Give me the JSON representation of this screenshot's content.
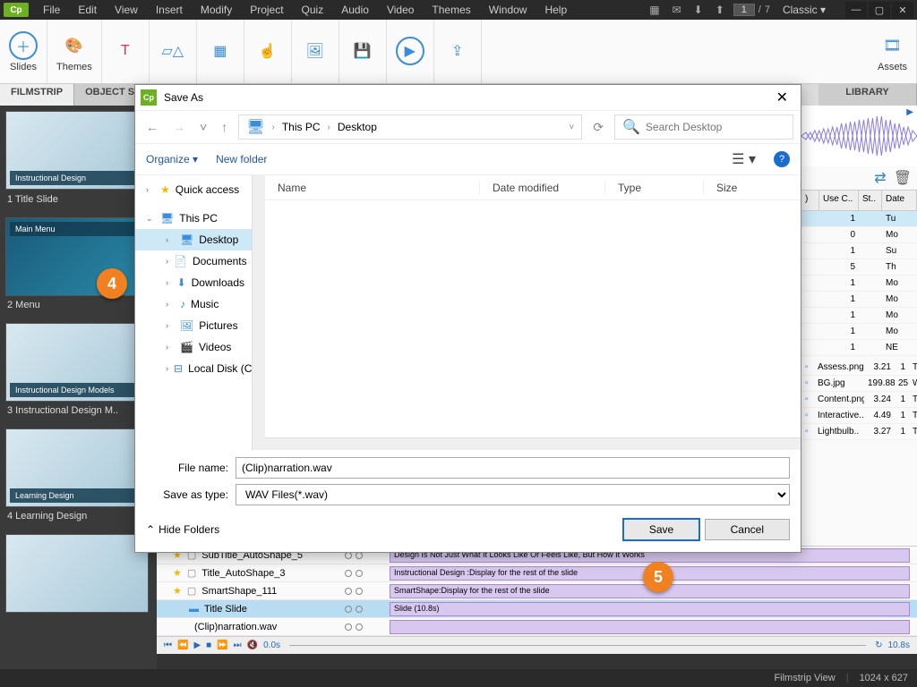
{
  "menu": [
    "File",
    "Edit",
    "View",
    "Insert",
    "Modify",
    "Project",
    "Quiz",
    "Audio",
    "Video",
    "Themes",
    "Window",
    "Help"
  ],
  "page": {
    "current": "1",
    "total": "7"
  },
  "workspace": "Classic",
  "ribbon": {
    "slides": "Slides",
    "themes": "Themes",
    "assets": "Assets"
  },
  "panel_tabs": {
    "filmstrip": "FILMSTRIP",
    "objstate": "OBJECT STA",
    "library": "LIBRARY"
  },
  "slides": [
    {
      "label": "1 Title Slide",
      "title": "Instructional Design"
    },
    {
      "label": "2 Menu",
      "title": "Main Menu"
    },
    {
      "label": "3 Instructional Design M..",
      "title": "Instructional Design Models"
    },
    {
      "label": "4 Learning Design",
      "title": "Learning Design"
    }
  ],
  "callouts": {
    "four": "4",
    "five": "5"
  },
  "dialog": {
    "title": "Save As",
    "crumb1": "This PC",
    "crumb2": "Desktop",
    "search_placeholder": "Search Desktop",
    "organize": "Organize",
    "newfolder": "New folder",
    "tree": {
      "quick": "Quick access",
      "thispc": "This PC",
      "desktop": "Desktop",
      "documents": "Documents",
      "downloads": "Downloads",
      "music": "Music",
      "pictures": "Pictures",
      "videos": "Videos",
      "local": "Local Disk (C:)"
    },
    "cols": {
      "name": "Name",
      "date": "Date modified",
      "type": "Type",
      "size": "Size"
    },
    "filename_label": "File name:",
    "filename": "(Clip)narration.wav",
    "type_label": "Save as type:",
    "type": "WAV Files(*.wav)",
    "hide": "Hide Folders",
    "save": "Save",
    "cancel": "Cancel"
  },
  "library_cols": {
    "usec": "Use C..",
    "st": "St..",
    "date": "Date"
  },
  "library_rows": [
    {
      "use": "1",
      "st": "",
      "d": "Tu"
    },
    {
      "use": "0",
      "st": "",
      "d": "Mo"
    },
    {
      "use": "1",
      "st": "",
      "d": "Su"
    },
    {
      "use": "5",
      "st": "",
      "d": "Th"
    },
    {
      "use": "1",
      "st": "",
      "d": "Mo"
    },
    {
      "use": "1",
      "st": "",
      "d": "Mo"
    },
    {
      "use": "1",
      "st": "",
      "d": "Mo"
    },
    {
      "use": "1",
      "st": "",
      "d": "Mo"
    },
    {
      "use": "1",
      "st": "",
      "d": "NE"
    }
  ],
  "library_files": [
    {
      "name": "Assess.png",
      "size": "3.21",
      "use": "1",
      "d": "Tu"
    },
    {
      "name": "BG.jpg",
      "size": "199.88",
      "use": "25",
      "d": "We"
    },
    {
      "name": "Content.png",
      "size": "3.24",
      "use": "1",
      "d": "Tu"
    },
    {
      "name": "Interactive..",
      "size": "4.49",
      "use": "1",
      "d": "Tu"
    },
    {
      "name": "Lightbulb..",
      "size": "3.27",
      "use": "1",
      "d": "Tu"
    }
  ],
  "timeline": {
    "rows": [
      {
        "name": "SubTitle_AutoShape_5",
        "clip": "Design Is Not Just What It Looks Like Or Feels Like, But How It Works"
      },
      {
        "name": "Title_AutoShape_3",
        "clip": "Instructional Design :Display for the rest of the slide"
      },
      {
        "name": "SmartShape_111",
        "clip": "SmartShape:Display for the rest of the slide"
      },
      {
        "name": "Title Slide",
        "clip": "Slide (10.8s)"
      },
      {
        "name": "(Clip)narration.wav",
        "clip": ""
      }
    ],
    "start": "0.0s",
    "end": "10.8s"
  },
  "status": {
    "view": "Filmstrip View",
    "dim": "1024 x 627"
  }
}
